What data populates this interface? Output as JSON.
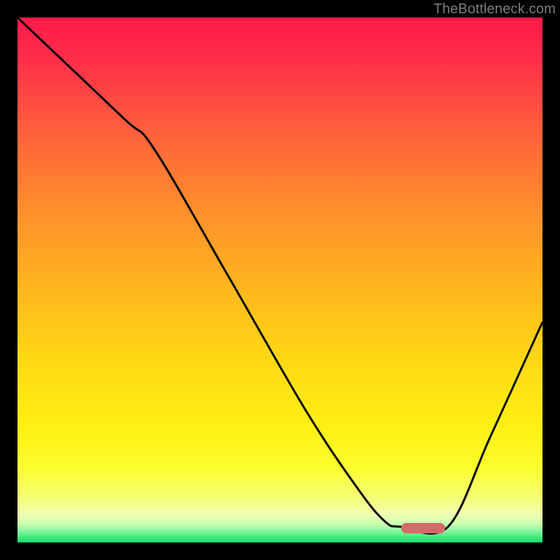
{
  "watermark": {
    "text": "TheBottleneck.com"
  },
  "colors": {
    "border": "#000000",
    "curve": "#000000",
    "marker": "#d46a6a",
    "gradient_stops": [
      {
        "offset": 0.0,
        "color": "#ff1a4a"
      },
      {
        "offset": 0.08,
        "color": "#ff2e4a"
      },
      {
        "offset": 0.2,
        "color": "#ff5a3d"
      },
      {
        "offset": 0.35,
        "color": "#ff8a2e"
      },
      {
        "offset": 0.5,
        "color": "#ffb21f"
      },
      {
        "offset": 0.65,
        "color": "#ffd814"
      },
      {
        "offset": 0.78,
        "color": "#fff012"
      },
      {
        "offset": 0.86,
        "color": "#fcff30"
      },
      {
        "offset": 0.91,
        "color": "#f5ff70"
      },
      {
        "offset": 0.945,
        "color": "#f0ffb0"
      },
      {
        "offset": 0.965,
        "color": "#c8ffb0"
      },
      {
        "offset": 0.98,
        "color": "#80f59a"
      },
      {
        "offset": 0.99,
        "color": "#3fe880"
      },
      {
        "offset": 1.0,
        "color": "#1fd865"
      }
    ]
  },
  "marker": {
    "x_frac": 0.73,
    "y_frac": 0.963,
    "w_frac": 0.085,
    "h_frac": 0.02
  },
  "chart_data": {
    "type": "line",
    "title": "",
    "xlabel": "",
    "ylabel": "",
    "xlim": [
      0,
      1
    ],
    "ylim": [
      0,
      1
    ],
    "note": "Values are fractional coordinates inside the plot area (0 = left/top)",
    "series": [
      {
        "name": "curve",
        "points": [
          {
            "x": 0.0,
            "y": 0.0
          },
          {
            "x": 0.2,
            "y": 0.19
          },
          {
            "x": 0.26,
            "y": 0.25
          },
          {
            "x": 0.4,
            "y": 0.49
          },
          {
            "x": 0.55,
            "y": 0.75
          },
          {
            "x": 0.65,
            "y": 0.9
          },
          {
            "x": 0.7,
            "y": 0.96
          },
          {
            "x": 0.73,
            "y": 0.97
          },
          {
            "x": 0.82,
            "y": 0.97
          },
          {
            "x": 0.9,
            "y": 0.8
          },
          {
            "x": 1.0,
            "y": 0.58
          }
        ]
      }
    ],
    "optimum_marker": {
      "x_center_frac": 0.77,
      "y_frac": 0.97
    }
  }
}
